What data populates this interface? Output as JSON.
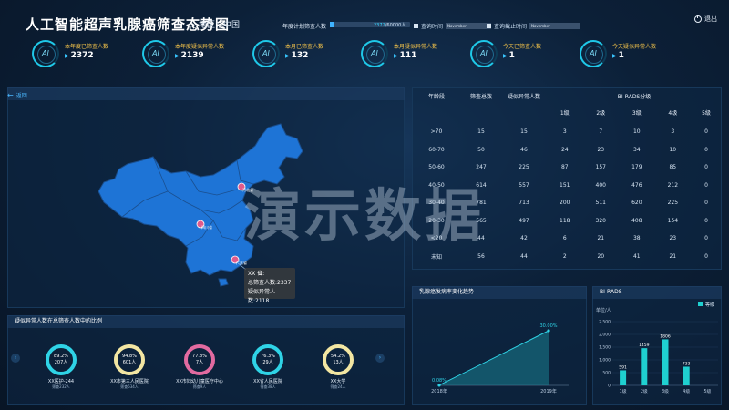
{
  "header": {
    "title": "人工智能超声乳腺癌筛查态势图",
    "region_label": "地区：中国",
    "plan_label": "年度计划筛查人数",
    "plan_done": "2372",
    "plan_total": "/60000人",
    "plan_fraction": 0.04,
    "query_time_label": "查询时间",
    "query_time_value": "November",
    "query_end_label": "查询截止时间",
    "query_end_value": "November",
    "exit_label": "退出"
  },
  "kpis": [
    {
      "label": "本年度已筛查人数",
      "value": "2372"
    },
    {
      "label": "本年度疑似异常人数",
      "value": "2139"
    },
    {
      "label": "本月已筛查人数",
      "value": "132"
    },
    {
      "label": "本月疑似异常人数",
      "value": "111"
    },
    {
      "label": "今天已筛查人数",
      "value": "1"
    },
    {
      "label": "今天疑似异常人数",
      "value": "1"
    }
  ],
  "map": {
    "back_label": "返回",
    "markers": [
      "河北省",
      "四川省",
      "广东省"
    ],
    "tooltip": {
      "line1": "XX 省:",
      "line2": "总筛查人数:2337",
      "line3": "疑似异常人数:2118"
    }
  },
  "watermark": "演示数据",
  "table": {
    "headers": [
      "年龄段",
      "筛查总数",
      "疑似异常人数",
      "BI-RADS分级"
    ],
    "grades": [
      "1级",
      "2级",
      "3级",
      "4级",
      "5级"
    ],
    "rows": [
      [
        ">70",
        "15",
        "15",
        "3",
        "7",
        "10",
        "3",
        "0"
      ],
      [
        "60-70",
        "50",
        "46",
        "24",
        "23",
        "34",
        "10",
        "0"
      ],
      [
        "50-60",
        "247",
        "225",
        "87",
        "157",
        "179",
        "85",
        "0"
      ],
      [
        "40-50",
        "614",
        "557",
        "151",
        "400",
        "476",
        "212",
        "0"
      ],
      [
        "30-40",
        "781",
        "713",
        "200",
        "511",
        "620",
        "225",
        "0"
      ],
      [
        "20-30",
        "565",
        "497",
        "118",
        "320",
        "408",
        "154",
        "0"
      ],
      [
        "<20",
        "44",
        "42",
        "6",
        "21",
        "38",
        "23",
        "0"
      ],
      [
        "未知",
        "56",
        "44",
        "2",
        "20",
        "41",
        "21",
        "0"
      ]
    ]
  },
  "ratio": {
    "title": "疑似异常人数在总筛查人数中的比例",
    "prev": "‹",
    "next": "›",
    "items": [
      {
        "pct": "89.2%",
        "count": "207人",
        "name": "XX医护-244",
        "sub": "筛查232人",
        "color": "#2fd3e6"
      },
      {
        "pct": "94.8%",
        "count": "601人",
        "name": "XX市第三人民医院",
        "sub": "筛查634人",
        "color": "#f3e6a2"
      },
      {
        "pct": "77.8%",
        "count": "7人",
        "name": "XX市妇幼儿童医疗中心",
        "sub": "筛查9人",
        "color": "#e26aa0"
      },
      {
        "pct": "76.3%",
        "count": "29人",
        "name": "XX省人民医院",
        "sub": "筛查38人",
        "color": "#2fd3e6"
      },
      {
        "pct": "54.2%",
        "count": "13人",
        "name": "XX大学",
        "sub": "筛查24人",
        "color": "#f3e6a2"
      }
    ]
  },
  "trend": {
    "title": "乳腺癌发病率变化趋势",
    "labels": [
      "0.08%",
      "30.00%"
    ]
  },
  "birads": {
    "title": "BI-RADS",
    "legend": "等级",
    "unit": "单位/人"
  },
  "chart_data": [
    {
      "type": "area",
      "title": "乳腺癌发病率变化趋势",
      "categories": [
        "2018年",
        "2019年"
      ],
      "values": [
        0.08,
        30.0
      ],
      "ylim": [
        0,
        30
      ]
    },
    {
      "type": "bar",
      "title": "BI-RADS",
      "categories": [
        "1级",
        "2级",
        "3级",
        "4级",
        "5级"
      ],
      "series": [
        {
          "name": "等级",
          "values": [
            591,
            1459,
            1806,
            733,
            0
          ]
        }
      ],
      "yticks": [
        "0",
        "500",
        "1,000",
        "1,500",
        "2,000",
        "2,500"
      ],
      "ylabel": "单位/人",
      "ylim": [
        0,
        2500
      ]
    }
  ]
}
